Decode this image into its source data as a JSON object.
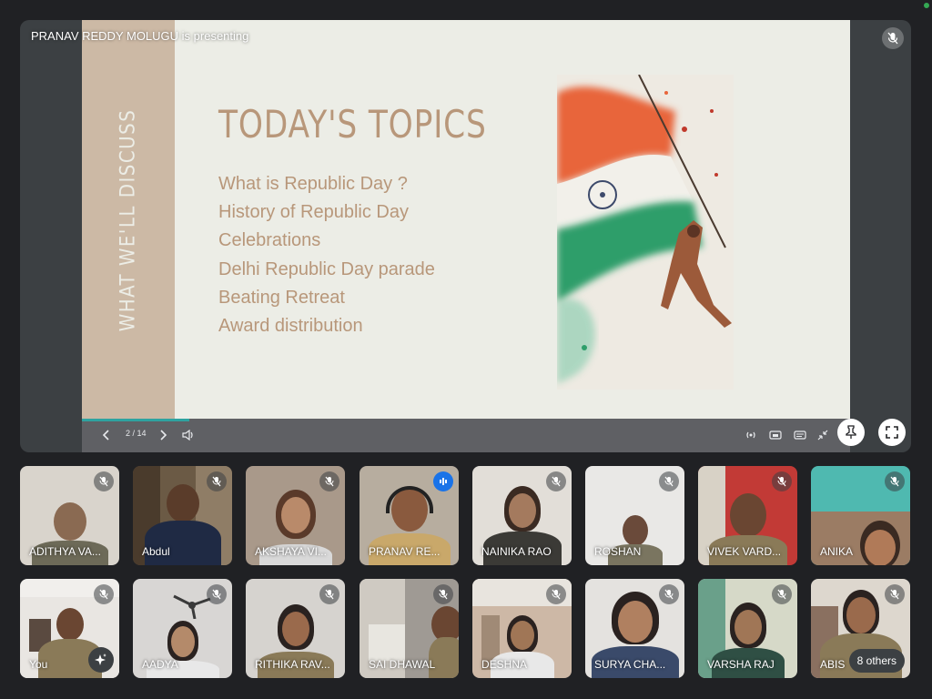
{
  "presenter": {
    "label": "PRANAV REDDY MOLUGU is presenting"
  },
  "slide": {
    "vertical_title": "WHAT WE'LL DISCUSS",
    "heading": "TODAY'S TOPICS",
    "topics": [
      "What is Republic Day ?",
      "History of Republic Day",
      "Celebrations",
      "Delhi Republic Day parade",
      "Beating Retreat",
      "Award distribution"
    ]
  },
  "controls": {
    "page_indicator": "2 / 14",
    "progress": 0.14,
    "accent": "#2ea3a0"
  },
  "participants_row1": [
    {
      "name": "ADITHYA VA...",
      "bg": "#d9d4cc",
      "mic": "muted-mic-icon"
    },
    {
      "name": "Abdul",
      "bg": "#6b5a45",
      "mic": "muted-mic-icon"
    },
    {
      "name": "AKSHAYA VI...",
      "bg": "#a9998a",
      "mic": "muted-mic-icon"
    },
    {
      "name": "PRANAV RE...",
      "bg": "#b7ad9f",
      "mic": "speaking-icon"
    },
    {
      "name": "NAINIKA RAO",
      "bg": "#e2ded8",
      "mic": "muted-mic-icon"
    },
    {
      "name": "ROSHAN",
      "bg": "#e9e8e6",
      "mic": "muted-mic-icon"
    },
    {
      "name": "VIVEK VARD...",
      "bg": "#c23a36",
      "mic": "muted-mic-icon"
    },
    {
      "name": "ANIKA",
      "bg": "#4fb9b0",
      "mic": "muted-mic-icon"
    }
  ],
  "participants_row2": [
    {
      "name": "You",
      "bg": "#f1efec",
      "mic": "muted-mic-icon"
    },
    {
      "name": "AADYA",
      "bg": "#d8d6d4",
      "mic": "muted-mic-icon"
    },
    {
      "name": "RITHIKA RAV...",
      "bg": "#d6d3cf",
      "mic": "muted-mic-icon"
    },
    {
      "name": "SAI DHAWAL",
      "bg": "#9f9a94",
      "mic": "muted-mic-icon"
    },
    {
      "name": "DESHNA",
      "bg": "#cdb8a6",
      "mic": "muted-mic-icon"
    },
    {
      "name": "SURYA CHA...",
      "bg": "#e4e2df",
      "mic": "muted-mic-icon"
    },
    {
      "name": "VARSHA RAJ",
      "bg": "#d6d9c8",
      "mic": "muted-mic-icon"
    },
    {
      "name": "ABIS",
      "bg": "#ddd7ce",
      "mic": "muted-mic-icon"
    }
  ],
  "others_label": "8 others"
}
